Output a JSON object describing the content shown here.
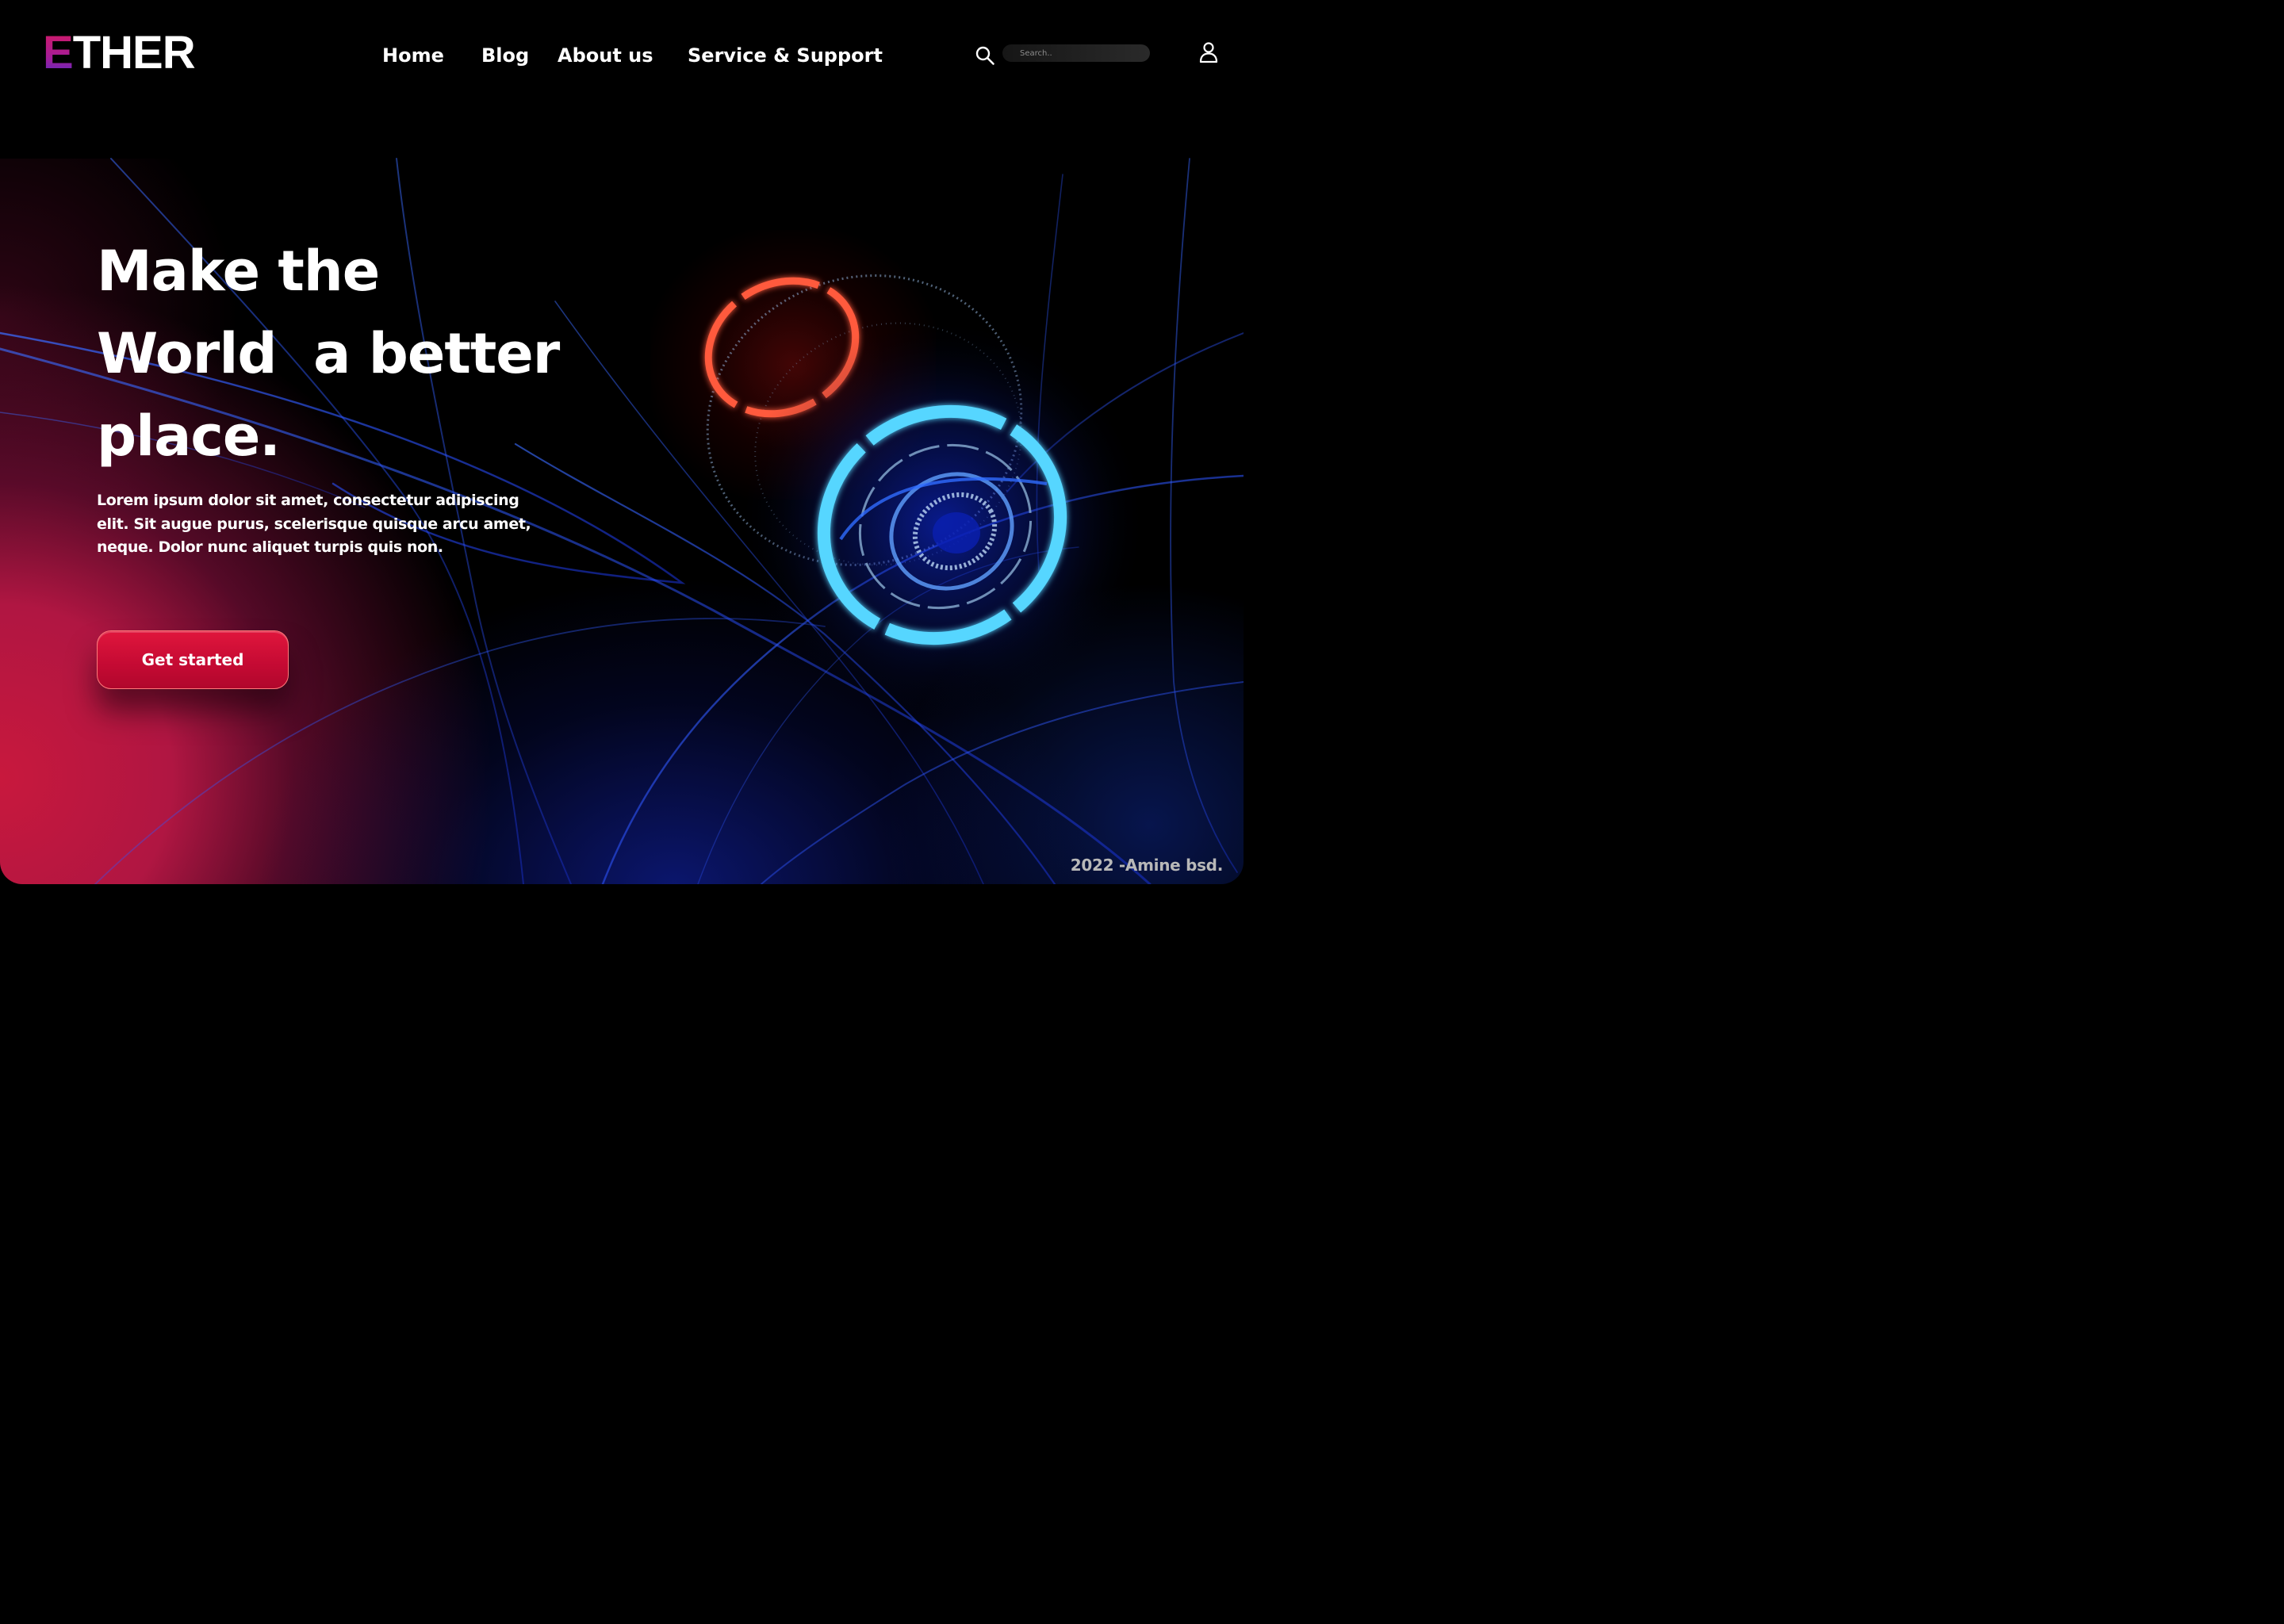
{
  "brand": {
    "logo_first_letter": "E",
    "logo_rest": "THER"
  },
  "nav": {
    "items": [
      "Home",
      "Blog",
      "About us",
      "Service & Support"
    ]
  },
  "search": {
    "placeholder": "Search.."
  },
  "hero": {
    "title_lines": [
      "Make the",
      "World  a better",
      "place."
    ],
    "body": "Lorem ipsum dolor sit amet, consectetur adipiscing elit. Sit augue purus, scelerisque quisque arcu amet, neque. Dolor nunc aliquet turpis quis non.",
    "cta_label": "Get started"
  },
  "footer": {
    "credit": "2022 -Amine bsd."
  },
  "icons": {
    "search": "search-icon",
    "user": "user-icon"
  },
  "colors": {
    "background": "#000000",
    "accent_red": "#d0103a",
    "logo_gradient_start": "#d81a5e",
    "logo_gradient_end": "#4b2ec9",
    "ring_red": "#ff5a3c",
    "ring_cyan": "#56d6ff"
  }
}
